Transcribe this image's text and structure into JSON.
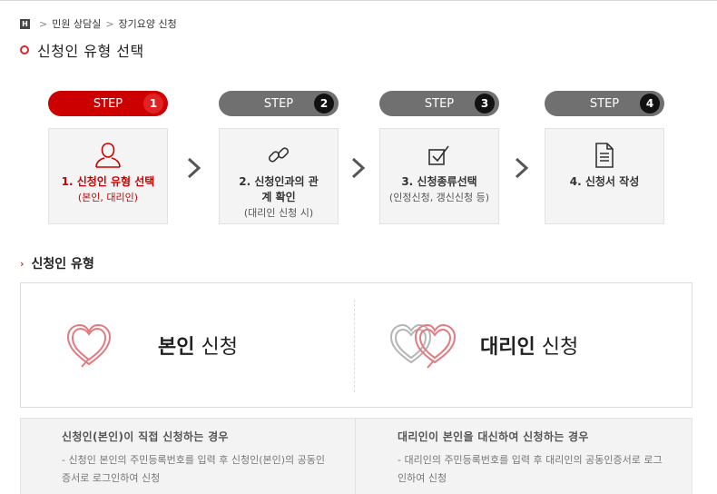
{
  "breadcrumb": {
    "home_icon": "H",
    "items": [
      "민원 상담실",
      "장기요양 신청"
    ],
    "separator": ">"
  },
  "page_title": "신청인 유형 선택",
  "steps": [
    {
      "label": "STEP",
      "number": "1",
      "title": "1. 신청인 유형 선택",
      "subtitle": "(본인, 대리인)",
      "icon": "person-icon",
      "active": true
    },
    {
      "label": "STEP",
      "number": "2",
      "title": "2. 신청인과의 관계 확인",
      "subtitle": "(대리인 신청 시)",
      "icon": "link-icon",
      "active": false
    },
    {
      "label": "STEP",
      "number": "3",
      "title": "3. 신청종류선택",
      "subtitle": "(인정신청, 갱신신청 등)",
      "icon": "checkbox-icon",
      "active": false
    },
    {
      "label": "STEP",
      "number": "4",
      "title": "4. 신청서 작성",
      "subtitle": "",
      "icon": "document-icon",
      "active": false
    }
  ],
  "section_title": "신청인 유형",
  "types": {
    "self": {
      "bold": "본인",
      "rest": " 신청",
      "icon": "heart-icon"
    },
    "proxy": {
      "bold": "대리인",
      "rest": " 신청",
      "icon": "double-heart-icon"
    }
  },
  "descriptions": {
    "self": {
      "title": "신청인(본인)이 직접 신청하는 경우",
      "body": "- 신청인 본인의 주민등록번호를 입력 후 신청인(본인)의 공동인증서로 로그인하여 신청"
    },
    "proxy": {
      "title": "대리인이 본인을 대신하여 신청하는 경우",
      "body": "- 대리인의 주민등록번호를 입력 후 대리인의 공동인증서로 로그인하여 신청"
    }
  },
  "colors": {
    "accent": "#cc0000",
    "inactive": "#707070",
    "box_bg": "#f4f4f4"
  }
}
